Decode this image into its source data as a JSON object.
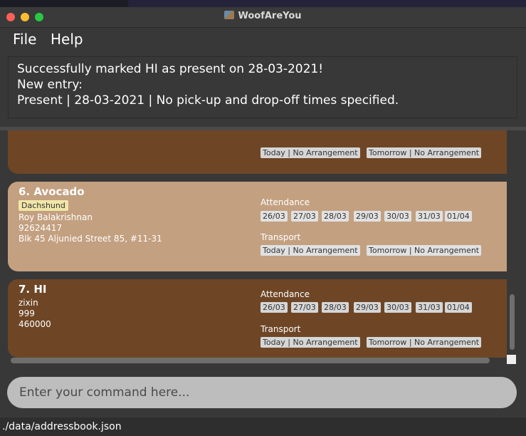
{
  "window": {
    "title": "WoofAreYou"
  },
  "menu": {
    "file": "File",
    "help": "Help"
  },
  "result": {
    "line1": "Successfully marked HI as present on 28-03-2021!",
    "line2": "New entry:",
    "line3": "Present | 28-03-2021 | No pick-up and drop-off times specified."
  },
  "cards": {
    "partial": {
      "transport": [
        "Today | No Arrangement",
        "Tomorrow | No Arrangement"
      ]
    },
    "avocado": {
      "index_name": "6.  Avocado",
      "breed": "Dachshund",
      "owner": "Roy Balakrishnan",
      "phone": "92624417",
      "address": "Blk 45 Aljunied Street 85, #11-31",
      "attendance_label": "Attendance",
      "dates": [
        "26/03",
        "27/03",
        "28/03",
        "29/03",
        "30/03",
        "31/03",
        "01/04"
      ],
      "transport_label": "Transport",
      "transport": [
        "Today | No Arrangement",
        "Tomorrow | No Arrangement"
      ]
    },
    "hi": {
      "index_name": "7.  HI",
      "owner": "zixin",
      "phone": "999",
      "address": "460000",
      "attendance_label": "Attendance",
      "dates": [
        "26/03",
        "27/03",
        "28/03",
        "29/03",
        "30/03",
        "31/03",
        "01/04"
      ],
      "transport_label": "Transport",
      "transport": [
        "Today | No Arrangement",
        "Tomorrow | No Arrangement"
      ]
    }
  },
  "command": {
    "placeholder": "Enter your command here..."
  },
  "status": {
    "path": "./data/addressbook.json"
  },
  "colors": {
    "card_dark": "#6e4626",
    "card_light": "#c3a080",
    "breed_tag": "#f0e6a8"
  }
}
